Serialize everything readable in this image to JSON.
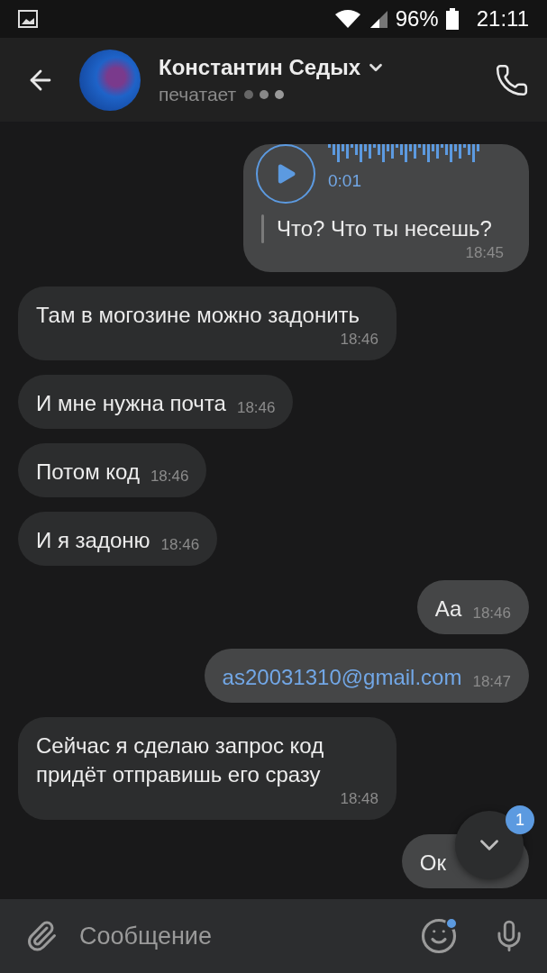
{
  "status_bar": {
    "battery": "96%",
    "time": "21:11"
  },
  "header": {
    "name": "Константин Седых",
    "status": "печатает"
  },
  "messages": [
    {
      "kind": "voice",
      "outgoing": true,
      "duration": "0:01",
      "text": "Что? Что ты несешь?",
      "time": "18:45"
    },
    {
      "kind": "text",
      "outgoing": false,
      "text": "Там в могозине можно задонить",
      "time": "18:46"
    },
    {
      "kind": "text",
      "outgoing": false,
      "text": "И мне нужна почта",
      "time": "18:46"
    },
    {
      "kind": "text",
      "outgoing": false,
      "text": "Потом код",
      "time": "18:46"
    },
    {
      "kind": "text",
      "outgoing": false,
      "text": "И я задоню",
      "time": "18:46"
    },
    {
      "kind": "text",
      "outgoing": true,
      "text": "Аа",
      "time": "18:46"
    },
    {
      "kind": "link",
      "outgoing": true,
      "text": "as20031310@gmail.com",
      "time": "18:47"
    },
    {
      "kind": "text",
      "outgoing": false,
      "text": "Сейчас я сделаю запрос код придёт отправишь его сразу",
      "time": "18:48"
    },
    {
      "kind": "text",
      "outgoing": true,
      "text": "Ок"
    }
  ],
  "scroll_button": {
    "badge": "1"
  },
  "composer": {
    "placeholder": "Сообщение",
    "emoji_dot": true
  }
}
